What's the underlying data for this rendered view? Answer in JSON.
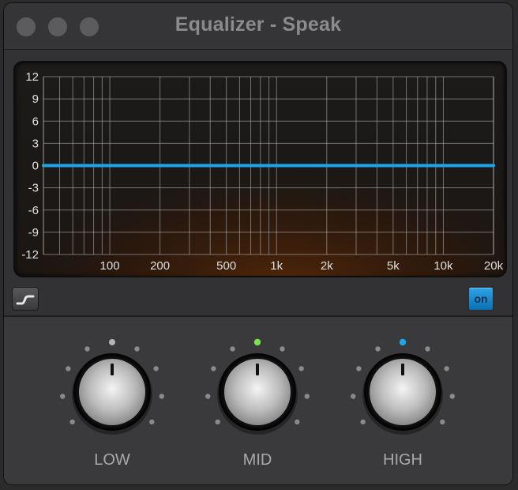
{
  "window": {
    "title": "Equalizer - Speak"
  },
  "eq_display": {
    "y_ticks": [
      "12",
      "9",
      "6",
      "3",
      "0",
      "-3",
      "-6",
      "-9",
      "-12"
    ],
    "x_ticks": [
      "100",
      "200",
      "500",
      "1k",
      "2k",
      "5k",
      "10k",
      "20k"
    ],
    "curve_gain_db": 0,
    "curve_color": "#1ba6ea"
  },
  "controls": {
    "on_label": "on"
  },
  "knobs": [
    {
      "label": "LOW",
      "led": "off"
    },
    {
      "label": "MID",
      "led": "#7ee04a"
    },
    {
      "label": "HIGH",
      "led": "#1ba6ea"
    }
  ],
  "colors": {
    "accent": "#1ba6ea",
    "mid_led": "#7ee04a",
    "background": "#323234"
  }
}
